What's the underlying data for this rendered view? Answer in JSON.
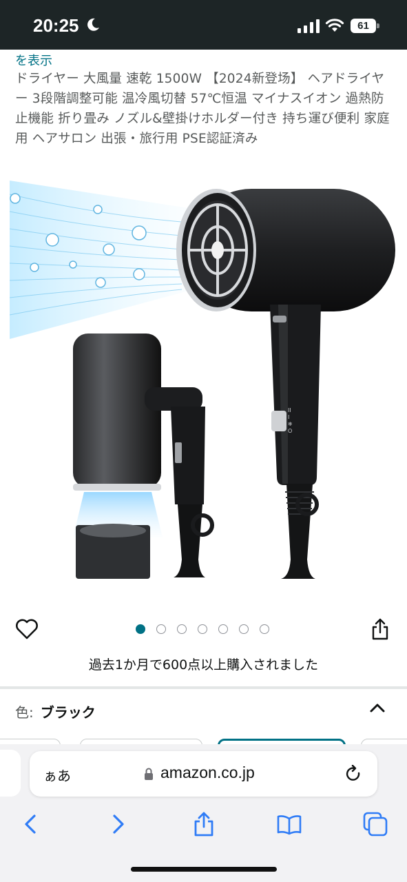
{
  "status_bar": {
    "time": "20:25",
    "battery": "61"
  },
  "product": {
    "see_more_link": "を表示",
    "title": "ドライヤー 大風量 速乾 1500W 【2024新登场】 ヘアドライヤー 3段階調整可能 温冷風切替 57℃恒温 マイナスイオン 過熱防止機能 折り畳み ノズル&壁掛けホルダー付き 持ち運び便利 家庭用 ヘアサロン 出張・旅行用 PSE認証済み",
    "image_alt": "hair-dryer-product-image",
    "switch_labels": [
      "II",
      "I",
      "❄",
      "O"
    ],
    "carousel": {
      "total": 7,
      "active_index": 0
    },
    "purchase_info": "過去1か月で600点以上購入されました",
    "color_label": "色:",
    "color_value": "ブラック"
  },
  "browser": {
    "text_size_button": "ぁあ",
    "url": "amazon.co.jp",
    "icons": [
      "back-icon",
      "forward-icon",
      "share-icon",
      "bookmarks-icon",
      "tabs-icon"
    ]
  },
  "colors": {
    "accent": "#007185",
    "status_bar_bg": "#1d2526",
    "safari_bg": "#f2f2f4"
  }
}
